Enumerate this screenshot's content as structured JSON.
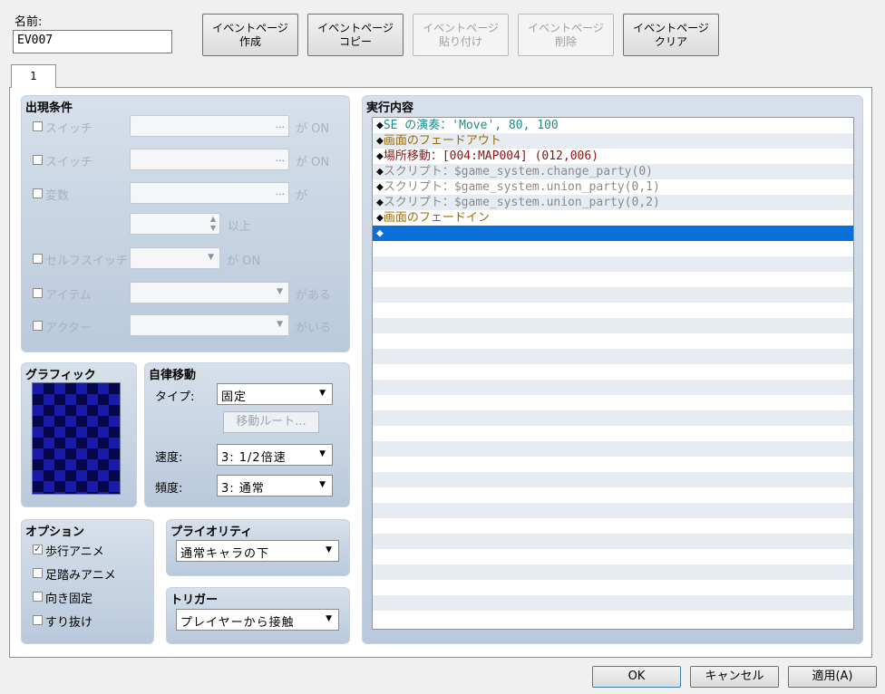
{
  "name": {
    "label": "名前:",
    "value": "EV007"
  },
  "page_buttons": [
    {
      "label": "イベントページ\n作成",
      "enabled": true
    },
    {
      "label": "イベントページ\nコピー",
      "enabled": true
    },
    {
      "label": "イベントページ\n貼り付け",
      "enabled": false
    },
    {
      "label": "イベントページ\n削除",
      "enabled": false
    },
    {
      "label": "イベントページ\nクリア",
      "enabled": true
    }
  ],
  "tab": {
    "label": "1"
  },
  "conditions": {
    "title": "出現条件",
    "switch1": {
      "label": "スイッチ",
      "suffix": "が ON",
      "dots": "..."
    },
    "switch2": {
      "label": "スイッチ",
      "suffix": "が ON",
      "dots": "..."
    },
    "variable": {
      "label": "変数",
      "suffix": "が",
      "dots": "...",
      "above": "以上"
    },
    "self_switch": {
      "label": "セルフスイッチ",
      "suffix": "が ON"
    },
    "item": {
      "label": "アイテム",
      "suffix": "がある"
    },
    "actor": {
      "label": "アクター",
      "suffix": "がいる"
    }
  },
  "graphic": {
    "title": "グラフィック"
  },
  "autonomous": {
    "title": "自律移動",
    "type_label": "タイプ:",
    "type_value": "固定",
    "route_button": "移動ルート...",
    "speed_label": "速度:",
    "speed_value": "3: 1/2倍速",
    "freq_label": "頻度:",
    "freq_value": "3: 通常"
  },
  "options": {
    "title": "オプション",
    "items": [
      {
        "label": "歩行アニメ",
        "checked": true
      },
      {
        "label": "足踏みアニメ",
        "checked": false
      },
      {
        "label": "向き固定",
        "checked": false
      },
      {
        "label": "すり抜け",
        "checked": false
      }
    ]
  },
  "priority": {
    "title": "プライオリティ",
    "value": "通常キャラの下"
  },
  "trigger": {
    "title": "トリガー",
    "value": "プレイヤーから接触"
  },
  "commands": {
    "title": "実行内容",
    "rows": [
      {
        "text": "SE の演奏：'Move', 80, 100",
        "color": "#1c8a8a"
      },
      {
        "text": "画面のフェードアウト",
        "color": "#9c6a00"
      },
      {
        "text": "場所移動：[004:MAP004] (012,006)",
        "color": "#8a1414"
      },
      {
        "text": "スクリプト：$game_system.change_party(0)",
        "color": "#8a8a8a"
      },
      {
        "text": "スクリプト：$game_system.union_party(0,1)",
        "color": "#8a8a8a"
      },
      {
        "text": "スクリプト：$game_system.union_party(0,2)",
        "color": "#8a8a8a"
      },
      {
        "text": "画面のフェードイン",
        "color": "#9c6a00"
      },
      {
        "text": "",
        "color": "#ffffff"
      }
    ],
    "diamond": "◆"
  },
  "bottom": {
    "ok": "OK",
    "cancel": "キャンセル",
    "apply": "適用(A)"
  }
}
